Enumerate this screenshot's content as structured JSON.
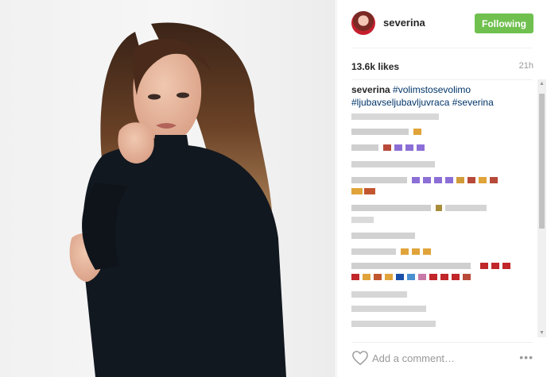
{
  "post": {
    "username": "severina",
    "follow_label": "Following",
    "likes": "13.6k likes",
    "time_ago": "21h",
    "caption": {
      "username": "severina",
      "hashtags": [
        "#volimstosevolimo",
        "#ljubavseljubavljuvraca",
        "#severina"
      ]
    },
    "add_comment_placeholder": "Add a comment…",
    "more_glyph": "•••"
  },
  "icons": {
    "heart": "heart-icon",
    "more": "more-options-icon",
    "avatar": "profile-avatar"
  },
  "colors": {
    "follow_button": "#70c050",
    "hashtag": "#003569",
    "text": "#262626",
    "muted": "#999999"
  }
}
